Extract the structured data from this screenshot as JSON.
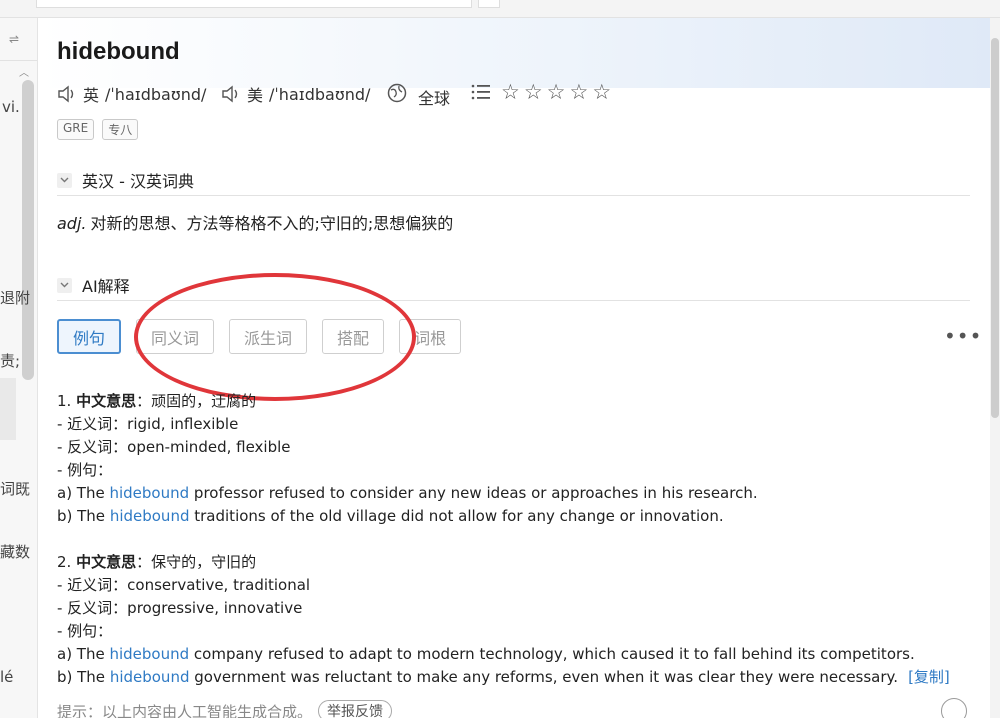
{
  "left_pane": {
    "swap_icon": "swap-icon",
    "fragments": [
      "vi.",
      "退附",
      "责;",
      "词既",
      "藏数",
      "lé"
    ]
  },
  "entry": {
    "word": "hidebound",
    "phonetics": [
      {
        "region": "英",
        "ipa": "/ˈhaɪdbaʊnd/"
      },
      {
        "region": "美",
        "ipa": "/ˈhaɪdbaʊnd/"
      }
    ],
    "global_label": "全球",
    "rating_stars": 5,
    "tags": [
      "GRE",
      "专八"
    ]
  },
  "sections": {
    "dict_title": "英汉 - 汉英词典",
    "ai_title": "AI解释"
  },
  "definition": {
    "pos": "adj.",
    "text": "对新的思想、方法等格格不入的;守旧的;思想偏狭的"
  },
  "tabs": [
    "例句",
    "同义词",
    "派生词",
    "搭配",
    "词根"
  ],
  "ai_content": {
    "meaning1": {
      "num": "1.",
      "label": "中文意思",
      "text": "：顽固的，迂腐的",
      "near": "- 近义词：rigid, inflexible",
      "anti": "- 反义词：open-minded, flexible",
      "examples_label": "- 例句：",
      "ex_a_pre": "a) The ",
      "ex_a_post": " professor refused to consider any new ideas or approaches in his research.",
      "ex_b_pre": "b) The ",
      "ex_b_post": " traditions of the old village did not allow for any change or innovation."
    },
    "meaning2": {
      "num": "2.",
      "label": "中文意思",
      "text": "：保守的，守旧的",
      "near": "- 近义词：conservative, traditional",
      "anti": "- 反义词：progressive, innovative",
      "examples_label": "- 例句：",
      "ex_a_pre": "a) The ",
      "ex_a_post": " company refused to adapt to modern technology, which caused it to fall behind its competitors.",
      "ex_b_pre": "b) The ",
      "ex_b_post": " government was reluctant to make any reforms, even when it was clear they were necessary."
    },
    "highlight_word": "hidebound",
    "copy_label": "[复制]"
  },
  "footer": {
    "notice": "提示：以上内容由人工智能生成合成。",
    "report_label": "举报反馈"
  },
  "colors": {
    "accent": "#2f7ac4",
    "annotation_circle": "#e0363a"
  }
}
